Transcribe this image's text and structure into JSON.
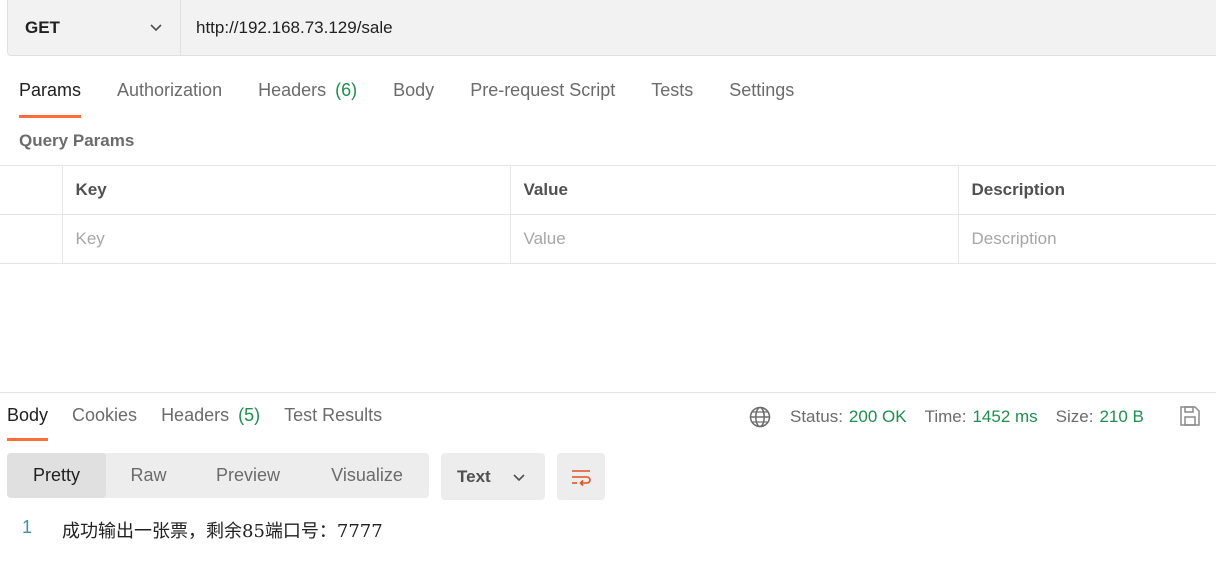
{
  "request": {
    "method": "GET",
    "url": "http://192.168.73.129/sale"
  },
  "request_tabs": [
    {
      "label": "Params"
    },
    {
      "label": "Authorization"
    },
    {
      "label": "Headers",
      "count": "(6)"
    },
    {
      "label": "Body"
    },
    {
      "label": "Pre-request Script"
    },
    {
      "label": "Tests"
    },
    {
      "label": "Settings"
    }
  ],
  "query_params": {
    "title": "Query Params",
    "headers": [
      "Key",
      "Value",
      "Description"
    ],
    "placeholders": [
      "Key",
      "Value",
      "Description"
    ]
  },
  "response_tabs": [
    {
      "label": "Body"
    },
    {
      "label": "Cookies"
    },
    {
      "label": "Headers",
      "count": "(5)"
    },
    {
      "label": "Test Results"
    }
  ],
  "status": {
    "status_label": "Status:",
    "status_value": "200 OK",
    "time_label": "Time:",
    "time_value": "1452 ms",
    "size_label": "Size:",
    "size_value": "210 B"
  },
  "view_modes": [
    "Pretty",
    "Raw",
    "Preview",
    "Visualize"
  ],
  "format": "Text",
  "response_body": {
    "line_number": "1",
    "text": "成功输出一张票，剩余85端口号：7777"
  },
  "colors": {
    "accent": "#ff6c37",
    "status_green": "#1f8f4e"
  }
}
